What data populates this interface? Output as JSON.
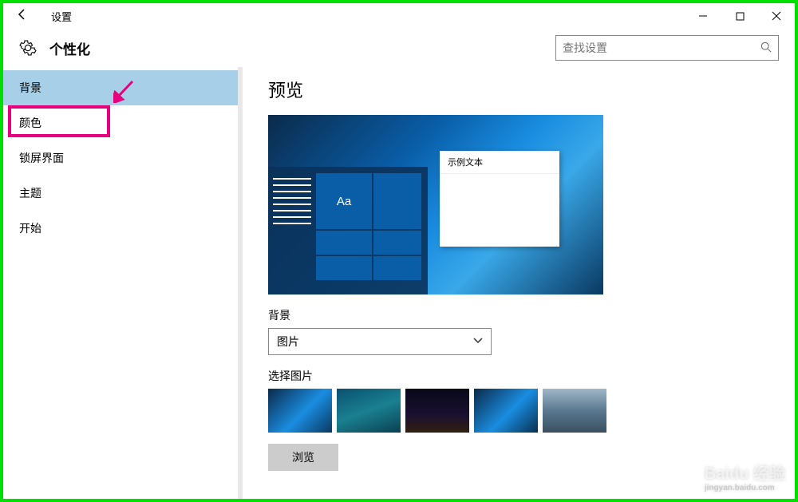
{
  "titlebar": {
    "title": "设置"
  },
  "header": {
    "heading": "个性化",
    "search_placeholder": "查找设置"
  },
  "sidebar": {
    "items": [
      {
        "label": "背景",
        "selected": true
      },
      {
        "label": "颜色",
        "highlighted": true
      },
      {
        "label": "锁屏界面"
      },
      {
        "label": "主题"
      },
      {
        "label": "开始"
      }
    ]
  },
  "content": {
    "preview_title": "预览",
    "preview_window_text": "示例文本",
    "preview_tile_text": "Aa",
    "background_label": "背景",
    "background_dropdown_value": "图片",
    "choose_picture_label": "选择图片",
    "thumbnails": [
      {
        "bg": "linear-gradient(135deg,#0b2a4a 0%,#1a8de0 55%,#0a3860 100%)"
      },
      {
        "bg": "linear-gradient(160deg,#0a5070 0%,#1a8090 50%,#0a4050 100%)"
      },
      {
        "bg": "linear-gradient(180deg,#080818 0%,#1a1030 60%,#302010 100%)"
      },
      {
        "bg": "linear-gradient(135deg,#0b2a4a 0%,#1a8de0 55%,#083050 100%)"
      },
      {
        "bg": "linear-gradient(180deg,#a0b8c8 0%,#5a7890 50%,#3a5060 100%)"
      }
    ],
    "browse_label": "浏览"
  },
  "watermark": {
    "main": "Baidu 经验",
    "sub": "jingyan.baidu.com"
  }
}
